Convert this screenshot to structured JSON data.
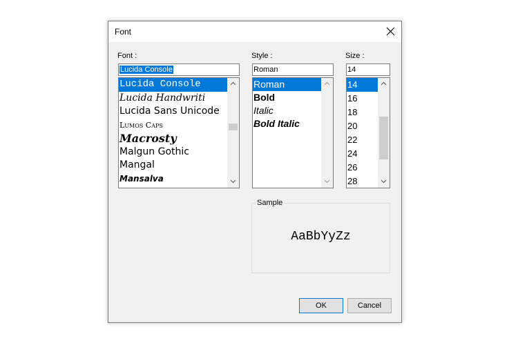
{
  "window": {
    "title": "Font"
  },
  "font": {
    "label": "Font :",
    "value": "Lucida Console",
    "items": [
      {
        "label": "Lucida Console",
        "family": "\"Liberation Mono\", monospace",
        "style": "normal",
        "weight": "normal",
        "size": "14px",
        "selected": true
      },
      {
        "label": "Lucida Handwriti",
        "family": "\"DejaVu Serif\", serif",
        "style": "italic",
        "weight": "normal",
        "size": "14px",
        "selected": false
      },
      {
        "label": "Lucida Sans Unicode",
        "family": "\"DejaVu Sans\", sans-serif",
        "style": "normal",
        "weight": "normal",
        "size": "14px",
        "selected": false
      },
      {
        "label": "Lumos Caps",
        "family": "\"DejaVu Serif\", serif",
        "style": "normal",
        "weight": "normal",
        "size": "11px",
        "selected": false,
        "smallcaps": true
      },
      {
        "label": "Macrosty",
        "family": "\"DejaVu Serif\", serif",
        "style": "italic",
        "weight": "bold",
        "size": "16px",
        "selected": false
      },
      {
        "label": "Malgun Gothic",
        "family": "\"DejaVu Sans\", sans-serif",
        "style": "normal",
        "weight": "normal",
        "size": "14px",
        "selected": false
      },
      {
        "label": "Mangal",
        "family": "\"DejaVu Sans\", sans-serif",
        "style": "normal",
        "weight": "normal",
        "size": "14px",
        "selected": false
      },
      {
        "label": "Mansalva",
        "family": "\"DejaVu Sans\", sans-serif",
        "style": "italic",
        "weight": "bold",
        "size": "12px",
        "selected": false
      }
    ]
  },
  "style": {
    "label": "Style :",
    "value": "Roman",
    "items": [
      {
        "label": "Roman",
        "style": "normal",
        "weight": "normal",
        "selected": true
      },
      {
        "label": "Bold",
        "style": "normal",
        "weight": "bold",
        "selected": false
      },
      {
        "label": "Italic",
        "style": "italic",
        "weight": "normal",
        "selected": false
      },
      {
        "label": "Bold Italic",
        "style": "italic",
        "weight": "bold",
        "selected": false
      }
    ]
  },
  "size": {
    "label": "Size :",
    "value": "14",
    "items": [
      {
        "label": "14",
        "selected": true
      },
      {
        "label": "16",
        "selected": false
      },
      {
        "label": "18",
        "selected": false
      },
      {
        "label": "20",
        "selected": false
      },
      {
        "label": "22",
        "selected": false
      },
      {
        "label": "24",
        "selected": false
      },
      {
        "label": "26",
        "selected": false
      },
      {
        "label": "28",
        "selected": false
      }
    ]
  },
  "sample": {
    "label": "Sample",
    "text": "AaBbYyZz"
  },
  "buttons": {
    "ok": "OK",
    "cancel": "Cancel"
  },
  "colors": {
    "selection": "#0078d7",
    "dialog_bg": "#f0f0f0",
    "border": "#7a7a7a"
  }
}
